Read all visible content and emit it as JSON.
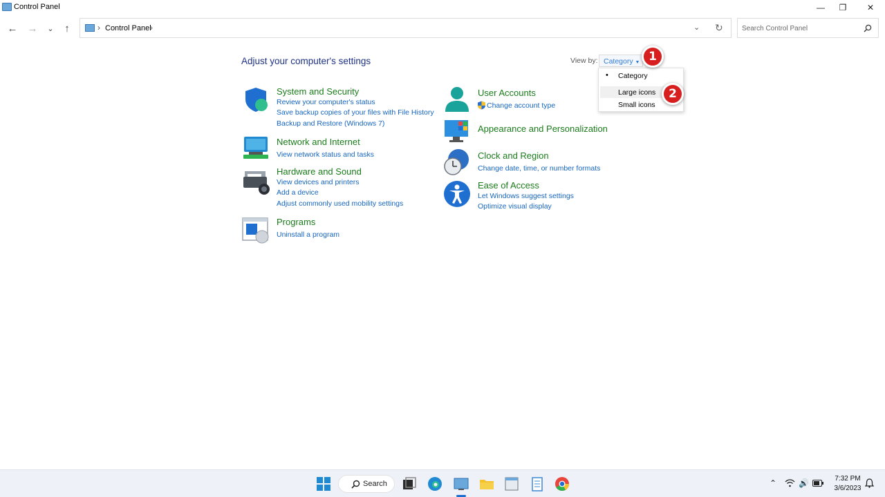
{
  "window": {
    "title": "Control Panel"
  },
  "address": {
    "breadcrumb": "Control Panel",
    "search_placeholder": "Search Control Panel"
  },
  "main": {
    "heading": "Adjust your computer's settings",
    "view_by_label": "View by:",
    "view_by_value": "Category",
    "view_menu": {
      "items": [
        "Category",
        "Large icons",
        "Small icons"
      ],
      "selected": "Category",
      "hovered": "Large icons"
    },
    "categories": [
      {
        "title": "System and Security",
        "icon": "shield-icon",
        "links": [
          "Review your computer's status",
          "Save backup copies of your files with File History",
          "Backup and Restore (Windows 7)"
        ]
      },
      {
        "title": "Network and Internet",
        "icon": "network-icon",
        "links": [
          "View network status and tasks"
        ]
      },
      {
        "title": "Hardware and Sound",
        "icon": "printer-icon",
        "links": [
          "View devices and printers",
          "Add a device",
          "Adjust commonly used mobility settings"
        ]
      },
      {
        "title": "Programs",
        "icon": "programs-icon",
        "links": [
          "Uninstall a program"
        ]
      },
      {
        "title": "User Accounts",
        "icon": "user-icon",
        "links": [
          "Change account type"
        ]
      },
      {
        "title": "Appearance and Personalization",
        "icon": "monitor-icon",
        "links": []
      },
      {
        "title": "Clock and Region",
        "icon": "clock-icon",
        "links": [
          "Change date, time, or number formats"
        ]
      },
      {
        "title": "Ease of Access",
        "icon": "accessibility-icon",
        "links": [
          "Let Windows suggest settings",
          "Optimize visual display"
        ]
      }
    ]
  },
  "annotations": {
    "step1": "1",
    "step2": "2"
  },
  "taskbar": {
    "search_label": "Search",
    "time": "7:32 PM",
    "date": "3/6/2023"
  },
  "colors": {
    "link": "#1565c0",
    "category_title": "#1a7c1a",
    "heading": "#1e3287",
    "accent": "#2f7ad6",
    "step_badge": "#d81f1f"
  }
}
